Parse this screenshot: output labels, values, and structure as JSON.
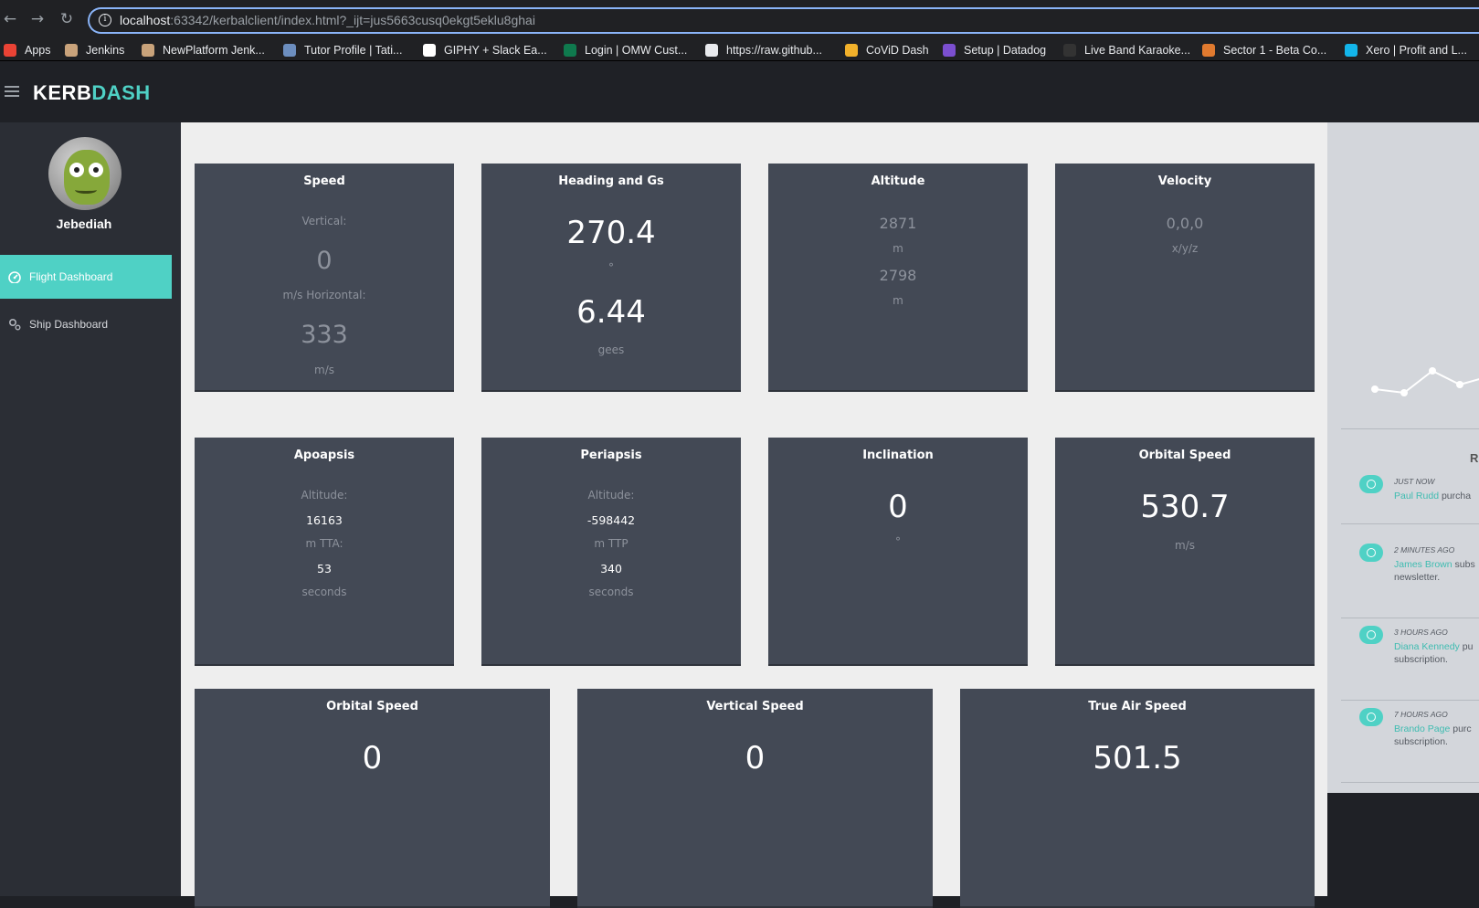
{
  "browser": {
    "url_host": "localhost",
    "url_rest": ":63342/kerbalclient/index.html?_ijt=jus5663cusq0ekgt5eklu8ghai",
    "bookmarks": [
      {
        "label": "Apps",
        "color": "#ea4335"
      },
      {
        "label": "Jenkins",
        "color": "#c9a37b"
      },
      {
        "label": "NewPlatform Jenk...",
        "color": "#c9a37b"
      },
      {
        "label": "Tutor Profile | Tati...",
        "color": "#6c8ebf"
      },
      {
        "label": "GIPHY + Slack Ea...",
        "color": "#ffffff"
      },
      {
        "label": "Login | OMW Cust...",
        "color": "#0f7a4e"
      },
      {
        "label": "https://raw.github...",
        "color": "#e8eaed"
      },
      {
        "label": "CoViD Dash",
        "color": "#f2b12b"
      },
      {
        "label": "Setup | Datadog",
        "color": "#7b4fd0"
      },
      {
        "label": "Live Band Karaoke...",
        "color": "#333333"
      },
      {
        "label": "Sector 1 - Beta Co...",
        "color": "#e07a2f"
      },
      {
        "label": "Xero | Profit and L...",
        "color": "#13b5ea"
      }
    ]
  },
  "app": {
    "brand_part1": "KERB",
    "brand_part2": "DASH",
    "accent": "#4fd1c5"
  },
  "sidebar": {
    "user_name": "Jebediah",
    "items": [
      {
        "label": "Flight Dashboard",
        "icon": "dashboard-icon",
        "active": true
      },
      {
        "label": "Ship Dashboard",
        "icon": "gears-icon",
        "active": false
      }
    ]
  },
  "cards": {
    "speed": {
      "title": "Speed",
      "vertical_label": "Vertical:",
      "vertical_value": "0",
      "horizontal_label": "m/s Horizontal:",
      "horizontal_value": "333",
      "unit": "m/s"
    },
    "heading": {
      "title": "Heading and Gs",
      "heading_value": "270.4",
      "heading_unit": "°",
      "gs_value": "6.44",
      "gs_unit": "gees"
    },
    "altitude": {
      "title": "Altitude",
      "value1": "2871",
      "unit1": "m",
      "value2": "2798",
      "unit2": "m"
    },
    "velocity": {
      "title": "Velocity",
      "value": "0,0,0",
      "unit": "x/y/z"
    },
    "apoapsis": {
      "title": "Apoapsis",
      "altitude_label": "Altitude:",
      "altitude_value": "16163",
      "tta_label": "m TTA:",
      "tta_value": "53",
      "unit": "seconds"
    },
    "periapsis": {
      "title": "Periapsis",
      "altitude_label": "Altitude:",
      "altitude_value": "-598442",
      "ttp_label": "m TTP",
      "ttp_value": "340",
      "unit": "seconds"
    },
    "inclination": {
      "title": "Inclination",
      "value": "0",
      "unit": "°"
    },
    "orbital_speed": {
      "title": "Orbital Speed",
      "value": "530.7",
      "unit": "m/s"
    },
    "orbital_speed_2": {
      "title": "Orbital Speed",
      "value": "0"
    },
    "vertical_speed": {
      "title": "Vertical Speed",
      "value": "0"
    },
    "true_air_speed": {
      "title": "True Air Speed",
      "value": "501.5"
    }
  },
  "right_panel": {
    "heading": "R",
    "activities": [
      {
        "time": "JUST NOW",
        "who": "Paul Rudd",
        "line1": " purcha",
        "line2": ""
      },
      {
        "time": "2 MINUTES AGO",
        "who": "James Brown",
        "line1": " subs",
        "line2": "newsletter."
      },
      {
        "time": "3 HOURS AGO",
        "who": "Diana Kennedy",
        "line1": " pu",
        "line2": "subscription."
      },
      {
        "time": "7 HOURS AGO",
        "who": "Brando Page",
        "line1": " purc",
        "line2": "subscription."
      }
    ]
  }
}
